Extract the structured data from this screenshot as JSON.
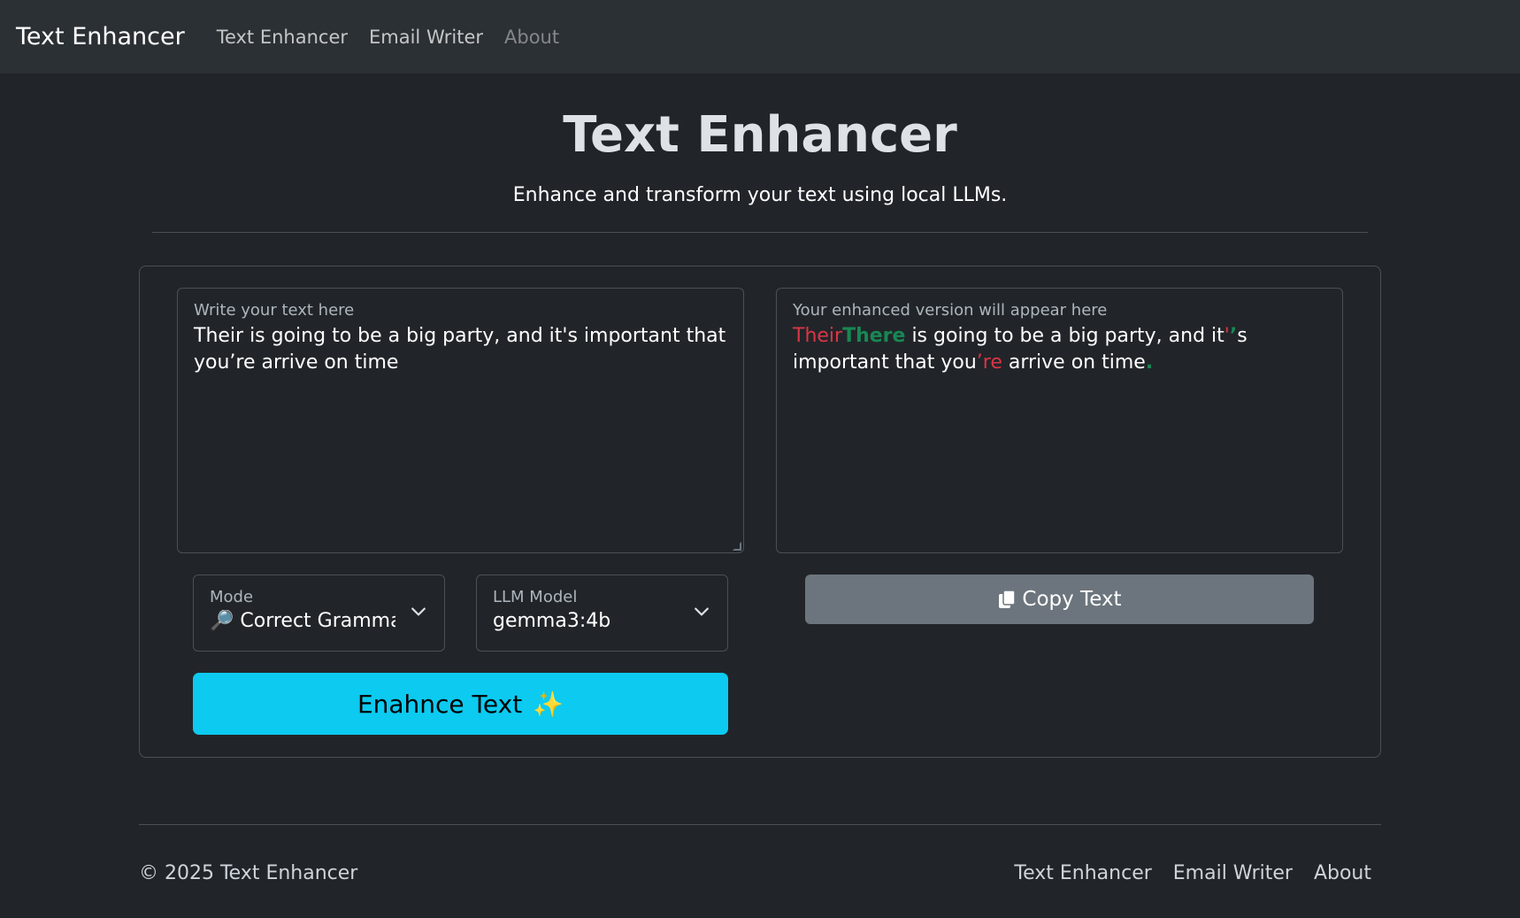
{
  "navbar": {
    "brand": "Text Enhancer",
    "links": [
      "Text Enhancer",
      "Email Writer",
      "About"
    ]
  },
  "header": {
    "title": "Text Enhancer",
    "subtitle": "Enhance and transform your text using local LLMs."
  },
  "input": {
    "label": "Write your text here",
    "value": "Their is going to be a big party, and it's important that you’re arrive on time"
  },
  "output": {
    "label": "Your enhanced version will appear here",
    "segments": [
      {
        "text": "Their",
        "type": "del"
      },
      {
        "text": "There",
        "type": "ins"
      },
      {
        "text": " is going to be a big party, and it",
        "type": "same"
      },
      {
        "text": "'",
        "type": "del"
      },
      {
        "text": "’",
        "type": "ins"
      },
      {
        "text": "s important that you",
        "type": "same"
      },
      {
        "text": "’re",
        "type": "del"
      },
      {
        "text": " arrive on time",
        "type": "same"
      },
      {
        "text": ".",
        "type": "ins"
      }
    ]
  },
  "mode_select": {
    "label": "Mode",
    "value": "🔎 Correct Grammar",
    "icon": "magnifier-icon"
  },
  "model_select": {
    "label": "LLM Model",
    "value": "gemma3:4b"
  },
  "enhance_button": {
    "label": "Enahnce Text",
    "icon": "✨"
  },
  "copy_button": {
    "label": "Copy Text",
    "icon": "copy-icon"
  },
  "footer": {
    "copyright": "© 2025 Text Enhancer",
    "links": [
      "Text Enhancer",
      "Email Writer",
      "About"
    ]
  },
  "colors": {
    "background": "#212529",
    "navbar": "#2b3035",
    "accent": "#0dcaf0",
    "secondary": "#6c757d",
    "deleted": "#dc3545",
    "inserted": "#198754"
  }
}
